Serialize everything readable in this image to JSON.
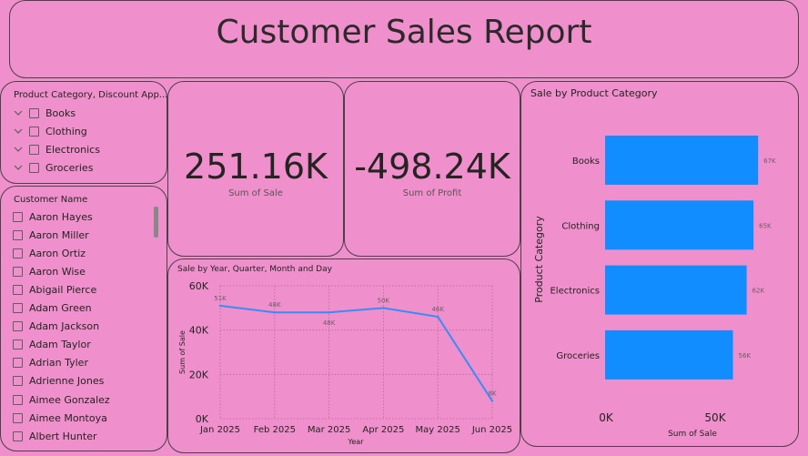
{
  "header": {
    "title": "Customer Sales Report"
  },
  "category_slicer": {
    "header": "Product Category, Discount App...",
    "items": [
      {
        "label": "Books"
      },
      {
        "label": "Clothing"
      },
      {
        "label": "Electronics"
      },
      {
        "label": "Groceries"
      }
    ]
  },
  "name_slicer": {
    "header": "Customer Name",
    "items": [
      {
        "label": "Aaron Hayes"
      },
      {
        "label": "Aaron Miller"
      },
      {
        "label": "Aaron Ortiz"
      },
      {
        "label": "Aaron Wise"
      },
      {
        "label": "Abigail Pierce"
      },
      {
        "label": "Adam Green"
      },
      {
        "label": "Adam Jackson"
      },
      {
        "label": "Adam Taylor"
      },
      {
        "label": "Adrian Tyler"
      },
      {
        "label": "Adrienne Jones"
      },
      {
        "label": "Aimee Gonzalez"
      },
      {
        "label": "Aimee Montoya"
      },
      {
        "label": "Albert Hunter"
      }
    ]
  },
  "kpi_sale": {
    "value": "251.16K",
    "label": "Sum of Sale"
  },
  "kpi_profit": {
    "value": "-498.24K",
    "label": "Sum of Profit"
  },
  "colors": {
    "background": "#ef8fcb",
    "accent": "#118dff",
    "line": "#3a8cf5",
    "border": "#4a4048"
  },
  "chart_data": [
    {
      "type": "line",
      "title": "Sale by Year, Quarter, Month and Day",
      "xlabel": "Year",
      "ylabel": "Sum of Sale",
      "categories": [
        "Jan 2025",
        "Feb 2025",
        "Mar 2025",
        "Apr 2025",
        "May 2025",
        "Jun 2025"
      ],
      "values": [
        51000,
        48000,
        48000,
        50000,
        46000,
        8000
      ],
      "data_labels": [
        "51K",
        "48K",
        "48K",
        "50K",
        "46K",
        "8K"
      ],
      "yticks": [
        "0K",
        "20K",
        "40K",
        "60K"
      ],
      "ylim": [
        0,
        60000
      ],
      "grid": true
    },
    {
      "type": "bar",
      "orientation": "horizontal",
      "title": "Sale by Product Category",
      "xlabel": "Sum of Sale",
      "ylabel": "Product Category",
      "categories": [
        "Books",
        "Clothing",
        "Electronics",
        "Groceries"
      ],
      "values": [
        67000,
        65000,
        62000,
        56000
      ],
      "data_labels": [
        "67K",
        "65K",
        "62K",
        "56K"
      ],
      "xticks": [
        "0K",
        "50K"
      ],
      "xlim": [
        0,
        100000
      ]
    }
  ]
}
